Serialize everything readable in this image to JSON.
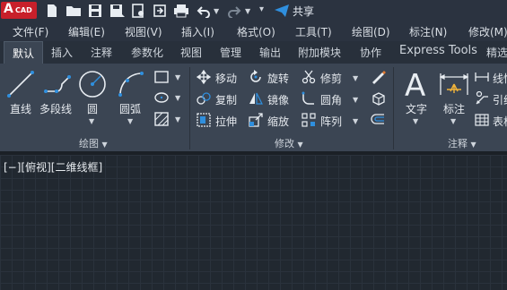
{
  "app": {
    "logo_letter": "A",
    "logo_sub": "CAD",
    "share_label": "共享"
  },
  "qat": {
    "icons": [
      "new-icon",
      "open-icon",
      "save-icon",
      "saveas-icon",
      "plot-preview-icon",
      "export-icon",
      "print-icon",
      "undo-icon",
      "redo-icon",
      "customize-icon"
    ]
  },
  "menu": [
    "文件(F)",
    "编辑(E)",
    "视图(V)",
    "插入(I)",
    "格式(O)",
    "工具(T)",
    "绘图(D)",
    "标注(N)",
    "修改(M)"
  ],
  "tabs": [
    "默认",
    "插入",
    "注释",
    "参数化",
    "视图",
    "管理",
    "输出",
    "附加模块",
    "协作",
    "Express Tools",
    "精选"
  ],
  "active_tab": "默认",
  "draw": {
    "line": "直线",
    "polyline": "多段线",
    "circle": "圆",
    "arc": "圆弧",
    "group_label": "绘图"
  },
  "modify": {
    "move": "移动",
    "rotate": "旋转",
    "trim": "修剪",
    "copy": "复制",
    "mirror": "镜像",
    "fillet": "圆角",
    "stretch": "拉伸",
    "scale": "缩放",
    "array": "阵列",
    "group_label": "修改"
  },
  "annotation": {
    "text": "文字",
    "dimension": "标注",
    "linear": "线性",
    "leader": "引线",
    "table": "表格",
    "group_label": "注释"
  },
  "viewport": {
    "label": "[−][俯视][二维线框]"
  },
  "colors": {
    "accent": "#2f8fde",
    "logo": "#c8202a",
    "ribbon": "#3b4553",
    "canvas": "#212830"
  }
}
